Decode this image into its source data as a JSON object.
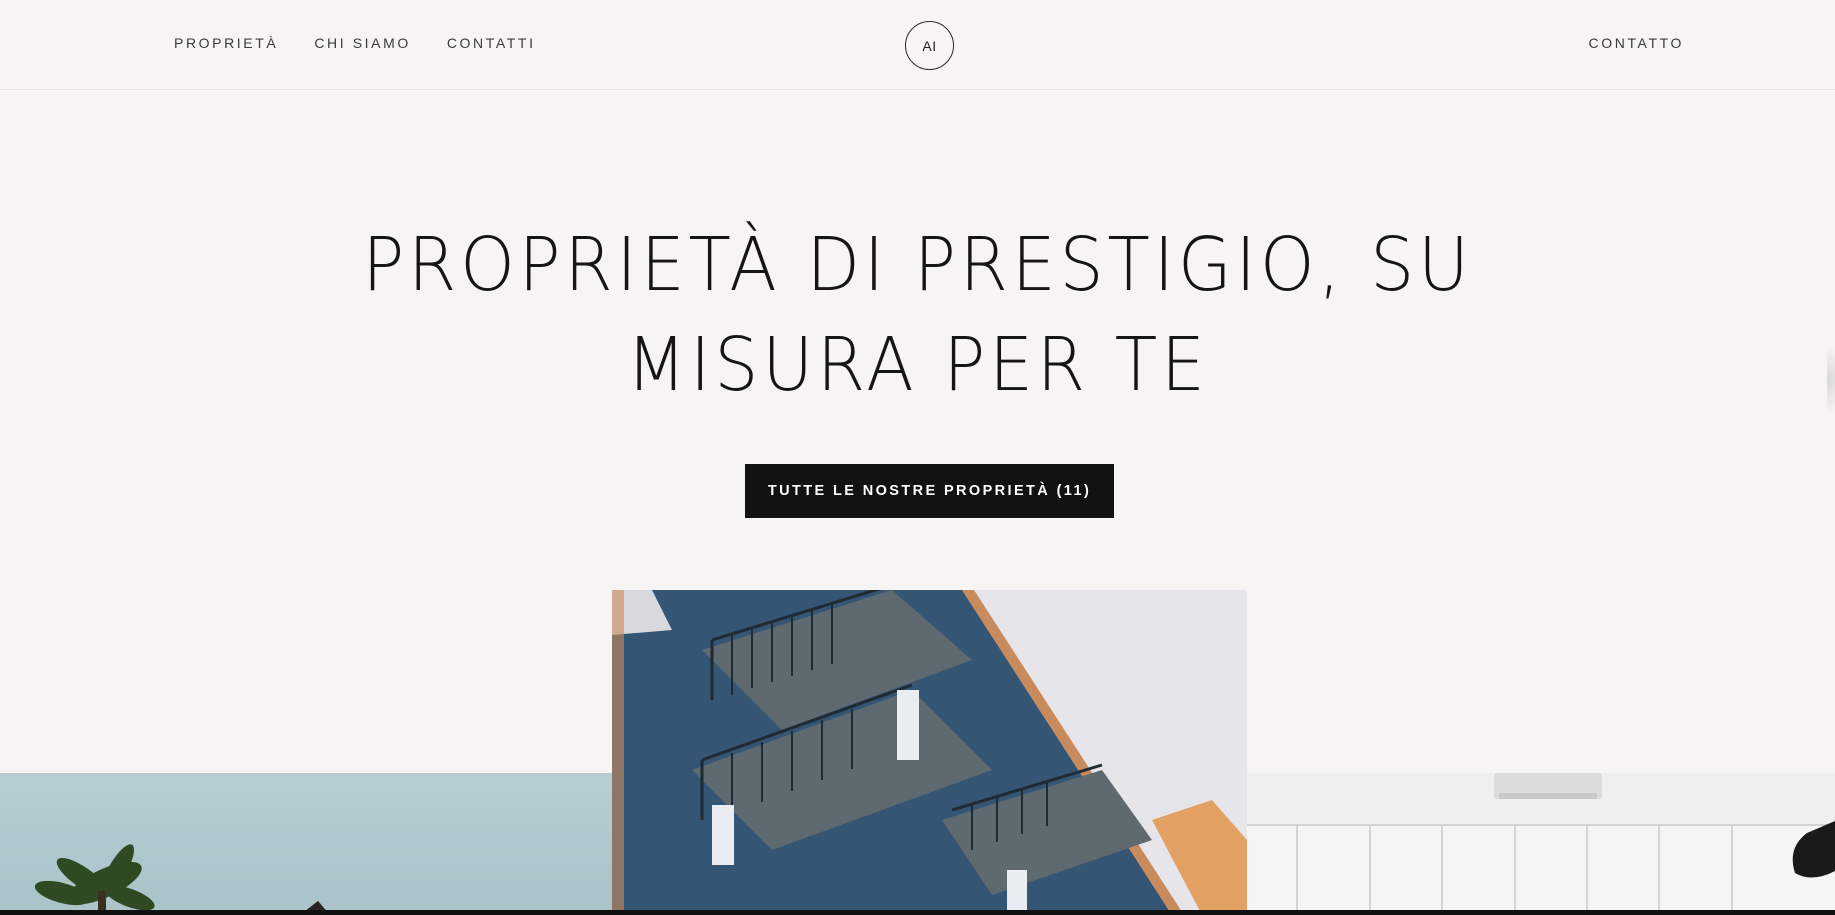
{
  "header": {
    "nav": [
      {
        "label": "PROPRIETÀ"
      },
      {
        "label": "CHI SIAMO"
      },
      {
        "label": "CONTATTI"
      }
    ],
    "logo_text": "AI",
    "contact_label": "CONTATTO"
  },
  "hero": {
    "title_line1": "PROPRIETÀ DI PRESTIGIO, SU",
    "title_line2": "MISURA PER TE",
    "cta_label": "TUTTE LE NOSTRE PROPRIETÀ (11)"
  },
  "colors": {
    "background": "#f6f5f3",
    "text": "#1a1a1a",
    "button": "#121212"
  }
}
